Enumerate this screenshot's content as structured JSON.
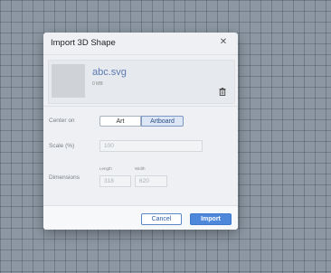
{
  "dialog": {
    "title": "Import 3D Shape",
    "close_icon": "close-icon"
  },
  "file": {
    "name": "abc.svg",
    "size": "0 MB",
    "delete_icon": "trash-icon"
  },
  "center_on": {
    "label": "Center on",
    "options": [
      "Art",
      "Artboard"
    ],
    "selected": "Artboard"
  },
  "scale": {
    "label": "Scale (%)",
    "value": "100"
  },
  "dimensions": {
    "label": "Dimensions",
    "length_label": "Length",
    "length_value": "318",
    "width_label": "Width",
    "width_value": "620"
  },
  "footer": {
    "cancel_label": "Cancel",
    "import_label": "Import"
  },
  "colors": {
    "accent": "#4d88da",
    "filename": "#5b7ab0"
  }
}
